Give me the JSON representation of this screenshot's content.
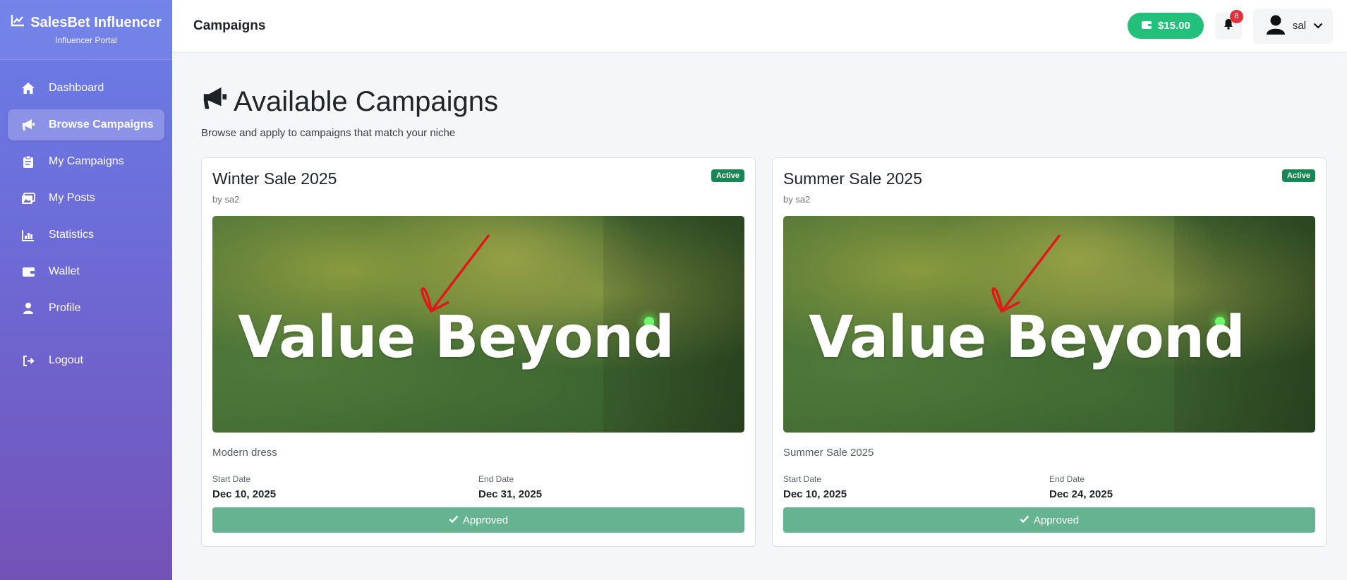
{
  "brand": {
    "name": "SalesBet Influencer",
    "subtitle": "Influencer Portal",
    "icon": "chart-line-icon"
  },
  "sidebar": {
    "items": [
      {
        "label": "Dashboard",
        "icon": "home-icon",
        "active": false
      },
      {
        "label": "Browse Campaigns",
        "icon": "megaphone-icon",
        "active": true
      },
      {
        "label": "My Campaigns",
        "icon": "clipboard-icon",
        "active": false
      },
      {
        "label": "My Posts",
        "icon": "images-icon",
        "active": false
      },
      {
        "label": "Statistics",
        "icon": "bar-chart-icon",
        "active": false
      },
      {
        "label": "Wallet",
        "icon": "wallet-icon",
        "active": false
      },
      {
        "label": "Profile",
        "icon": "user-icon",
        "active": false
      }
    ],
    "logout": {
      "label": "Logout",
      "icon": "logout-icon"
    }
  },
  "topbar": {
    "title": "Campaigns",
    "wallet_balance": "$15.00",
    "notifications_count": "8",
    "user_name": "sal"
  },
  "main": {
    "heading": "Available Campaigns",
    "subtext": "Browse and apply to campaigns that match your niche"
  },
  "campaigns": [
    {
      "title": "Winter Sale 2025",
      "by": "by sa2",
      "status": "Active",
      "banner_text": "Value Beyond",
      "description": "Modern dress",
      "start_label": "Start Date",
      "start_date": "Dec 10, 2025",
      "end_label": "End Date",
      "end_date": "Dec 31, 2025",
      "action_label": "Approved"
    },
    {
      "title": "Summer Sale 2025",
      "by": "by sa2",
      "status": "Active",
      "banner_text": "Value Beyond",
      "description": "Summer Sale 2025",
      "start_label": "Start Date",
      "start_date": "Dec 10, 2025",
      "end_label": "End Date",
      "end_date": "Dec 24, 2025",
      "action_label": "Approved"
    }
  ],
  "colors": {
    "sidebar_top": "#6b7ee8",
    "sidebar_bottom": "#7352b8",
    "wallet_green": "#22c07a",
    "status_green": "#198754",
    "approved_green": "#66b392",
    "badge_red": "#e0303e"
  }
}
